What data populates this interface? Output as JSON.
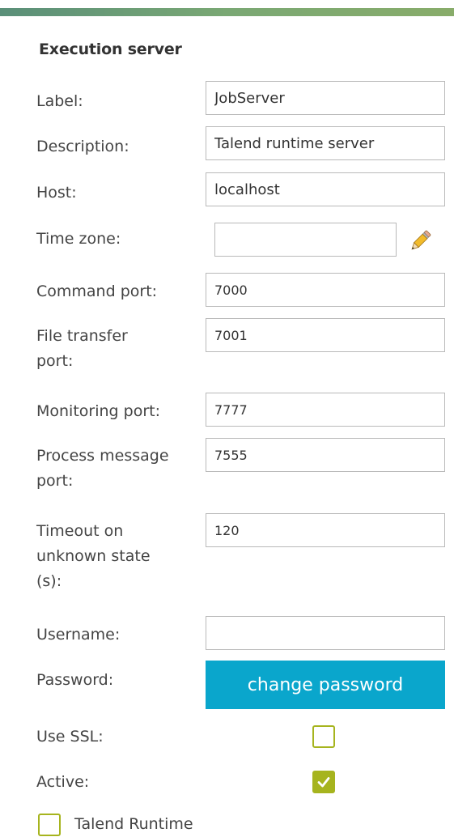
{
  "form": {
    "section_title": "Execution server",
    "fields": {
      "label": {
        "label": "Label:",
        "value": "JobServer"
      },
      "description": {
        "label": "Description:",
        "value": "Talend runtime server"
      },
      "host": {
        "label": "Host:",
        "value": "localhost"
      },
      "time_zone": {
        "label": "Time zone:",
        "value": ""
      },
      "command_port": {
        "label": "Command port:",
        "value": "7000"
      },
      "file_transfer_port": {
        "label_line1": "File transfer",
        "label_line2": "port:",
        "value": "7001"
      },
      "monitoring_port": {
        "label": "Monitoring port:",
        "value": "7777"
      },
      "process_message_port": {
        "label_line1": "Process message",
        "label_line2": "port:",
        "value": "7555"
      },
      "timeout": {
        "label_line1": "Timeout on",
        "label_line2": "unknown state",
        "label_line3": "(s):",
        "value": "120"
      },
      "username": {
        "label": "Username:",
        "value": ""
      },
      "password": {
        "label": "Password:",
        "button_label": "change password"
      },
      "use_ssl": {
        "label": "Use SSL:",
        "checked": false
      },
      "active": {
        "label": "Active:",
        "checked": true
      },
      "talend_runtime": {
        "label": "Talend Runtime",
        "checked": false
      }
    }
  },
  "icons": {
    "edit": "pencil-icon",
    "check": "checkmark-icon"
  },
  "colors": {
    "accent_blue": "#0aa6cc",
    "checkbox_green": "#a6b41e",
    "header_bar": "#6c9b76"
  }
}
